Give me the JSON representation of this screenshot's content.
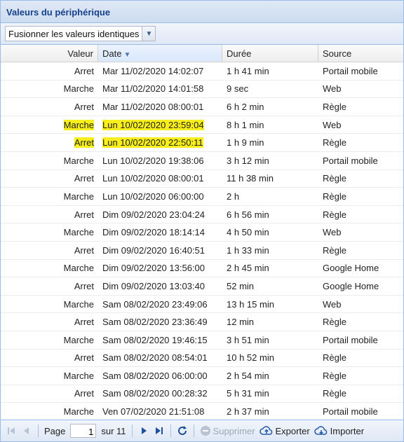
{
  "panel": {
    "title": "Valeurs du périphérique"
  },
  "toolbar": {
    "combo_value": "Fusionner les valeurs identiques"
  },
  "columns": {
    "value": "Valeur",
    "date": "Date",
    "duration": "Durée",
    "source": "Source"
  },
  "rows": [
    {
      "value": "Arret",
      "date": "Mar 11/02/2020 14:02:07",
      "duration": "1 h 41 min",
      "source": "Portail mobile"
    },
    {
      "value": "Marche",
      "date": "Mar 11/02/2020 14:01:58",
      "duration": "9 sec",
      "source": "Web"
    },
    {
      "value": "Arret",
      "date": "Mar 11/02/2020 08:00:01",
      "duration": "6 h 2 min",
      "source": "Règle"
    },
    {
      "value": "Marche",
      "date": "Lun 10/02/2020 23:59:04",
      "duration": "8 h 1 min",
      "source": "Web"
    },
    {
      "value": "Arret",
      "date": "Lun 10/02/2020 22:50:11",
      "duration": "1 h 9 min",
      "source": "Règle"
    },
    {
      "value": "Marche",
      "date": "Lun 10/02/2020 19:38:06",
      "duration": "3 h 12 min",
      "source": "Portail mobile"
    },
    {
      "value": "Arret",
      "date": "Lun 10/02/2020 08:00:01",
      "duration": "11 h 38 min",
      "source": "Règle"
    },
    {
      "value": "Marche",
      "date": "Lun 10/02/2020 06:00:00",
      "duration": "2 h",
      "source": "Règle"
    },
    {
      "value": "Arret",
      "date": "Dim 09/02/2020 23:04:24",
      "duration": "6 h 56 min",
      "source": "Règle"
    },
    {
      "value": "Marche",
      "date": "Dim 09/02/2020 18:14:14",
      "duration": "4 h 50 min",
      "source": "Web"
    },
    {
      "value": "Arret",
      "date": "Dim 09/02/2020 16:40:51",
      "duration": "1 h 33 min",
      "source": "Règle"
    },
    {
      "value": "Marche",
      "date": "Dim 09/02/2020 13:56:00",
      "duration": "2 h 45 min",
      "source": "Google Home"
    },
    {
      "value": "Arret",
      "date": "Dim 09/02/2020 13:03:40",
      "duration": "52 min",
      "source": "Google Home"
    },
    {
      "value": "Marche",
      "date": "Sam 08/02/2020 23:49:06",
      "duration": "13 h 15 min",
      "source": "Web"
    },
    {
      "value": "Arret",
      "date": "Sam 08/02/2020 23:36:49",
      "duration": "12 min",
      "source": "Règle"
    },
    {
      "value": "Marche",
      "date": "Sam 08/02/2020 19:46:15",
      "duration": "3 h 51 min",
      "source": "Portail mobile"
    },
    {
      "value": "Arret",
      "date": "Sam 08/02/2020 08:54:01",
      "duration": "10 h 52 min",
      "source": "Règle"
    },
    {
      "value": "Marche",
      "date": "Sam 08/02/2020 06:00:00",
      "duration": "2 h 54 min",
      "source": "Règle"
    },
    {
      "value": "Arret",
      "date": "Sam 08/02/2020 00:28:32",
      "duration": "5 h 31 min",
      "source": "Règle"
    },
    {
      "value": "Marche",
      "date": "Ven 07/02/2020 21:51:08",
      "duration": "2 h 37 min",
      "source": "Portail mobile"
    }
  ],
  "highlight": {
    "rows": [
      3,
      4
    ],
    "color": "#f7ef1d"
  },
  "paging": {
    "page_label": "Page",
    "current_page": "1",
    "of_label": "sur 11",
    "delete_label": "Supprimer",
    "export_label": "Exporter",
    "import_label": "Importer",
    "icons": [
      "first-page-icon",
      "prev-page-icon",
      "next-page-icon",
      "last-page-icon",
      "refresh-icon",
      "delete-icon",
      "export-icon",
      "import-icon"
    ]
  }
}
